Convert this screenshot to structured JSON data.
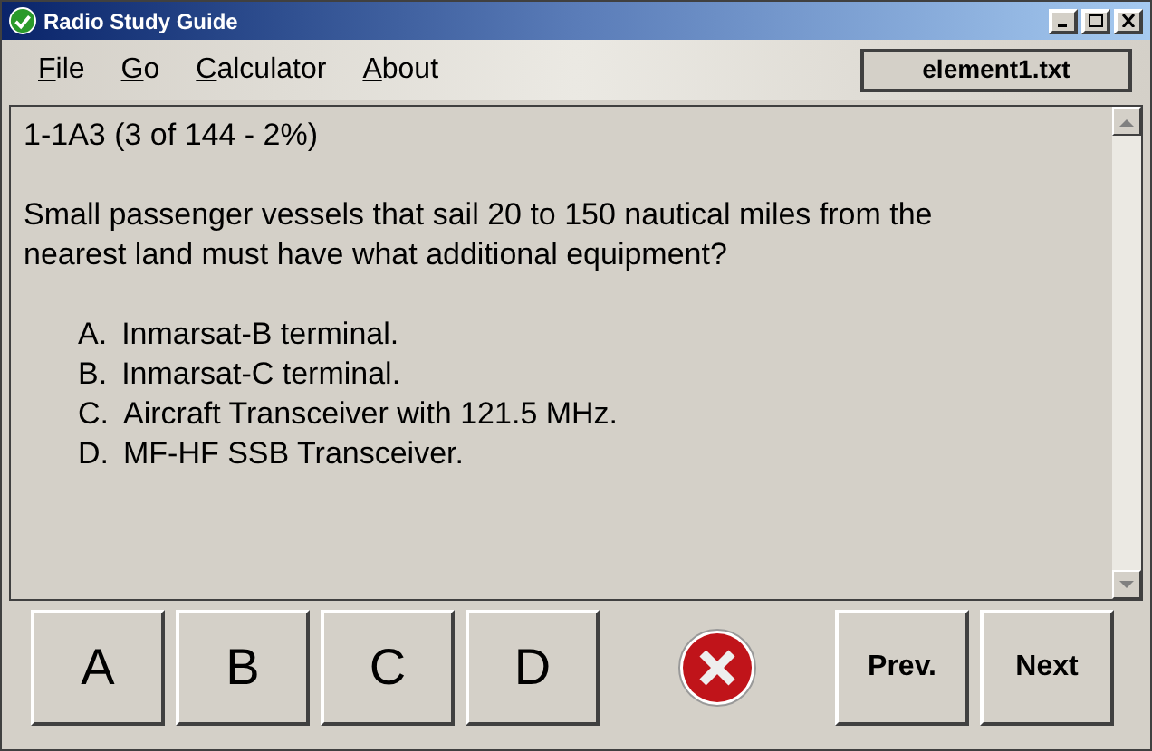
{
  "window": {
    "title": "Radio Study Guide"
  },
  "menu": [
    "File",
    "Go",
    "Calculator",
    "About"
  ],
  "file_label": "element1.txt",
  "question": {
    "header": "1-1A3 (3 of 144 - 2%)",
    "text": "Small passenger vessels that sail 20 to 150 nautical miles from the nearest land must have what additional equipment?",
    "answers": [
      {
        "letter": "A.",
        "text": "Inmarsat-B terminal."
      },
      {
        "letter": "B.",
        "text": "Inmarsat-C terminal."
      },
      {
        "letter": "C.",
        "text": "Aircraft Transceiver with 121.5 MHz."
      },
      {
        "letter": "D.",
        "text": "MF-HF SSB Transceiver."
      }
    ]
  },
  "answer_buttons": [
    "A",
    "B",
    "C",
    "D"
  ],
  "result": {
    "kind": "wrong"
  },
  "nav_buttons": [
    "Prev.",
    "Next"
  ]
}
